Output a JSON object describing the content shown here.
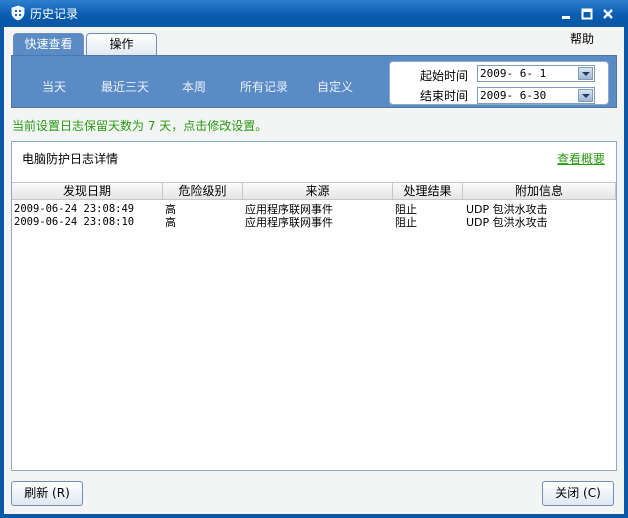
{
  "window": {
    "title": "历史记录"
  },
  "menu": {
    "help": "帮助"
  },
  "tabs": [
    {
      "label": "快速查看",
      "active": true
    },
    {
      "label": "操作",
      "active": false
    }
  ],
  "quick_filters": [
    "当天",
    "最近三天",
    "本周",
    "所有记录",
    "自定义"
  ],
  "date_range": {
    "start_label": "起始时间",
    "start_value": "2009- 6- 1",
    "end_label": "结束时间",
    "end_value": "2009- 6-30"
  },
  "retention_notice": "当前设置日志保留天数为 7 天，点击修改设置。",
  "log": {
    "title": "电脑防护日志详情",
    "overview_link": "查看概要",
    "columns": [
      "发现日期",
      "危险级别",
      "来源",
      "处理结果",
      "附加信息"
    ],
    "rows": [
      {
        "date": "2009-06-24 23:08:49",
        "level": "高",
        "source": "应用程序联网事件",
        "result": "阻止",
        "info": "UDP 包洪水攻击"
      },
      {
        "date": "2009-06-24 23:08:10",
        "level": "高",
        "source": "应用程序联网事件",
        "result": "阻止",
        "info": "UDP 包洪水攻击"
      }
    ]
  },
  "buttons": {
    "refresh": "刷新 (R)",
    "close": "关闭 (C)"
  },
  "colors": {
    "titlebar": "#0a58a6",
    "panel": "#5b8bc4",
    "link_green": "#2a9a12"
  }
}
